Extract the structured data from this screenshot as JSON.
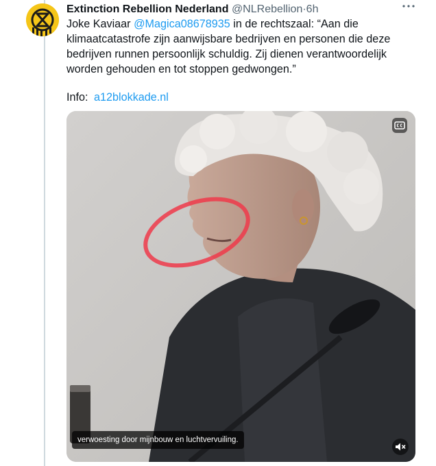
{
  "author": {
    "display_name": "Extinction Rebellion Nederland",
    "handle": "@NLRebellion",
    "separator": "·",
    "time": "6h",
    "avatar_icon": "extinction-symbol-icon",
    "avatar_color": "#f5c518"
  },
  "tweet": {
    "line1_prefix": "Joke Kaviaar",
    "mention": "@Magica08678935",
    "line1_suffix": "in de rechtszaal: “Aan die",
    "line2": "klimaatcatastrofe zijn aanwijsbare bedrijven en personen die deze",
    "line3": "bedrijven runnen persoonlijk schuldig. Zij dienen verantwoordelijk",
    "line4": "worden gehouden en tot stoppen gedwongen.”",
    "info_label": "Info:",
    "info_link": "a12blokkade.nl"
  },
  "media": {
    "caption": "verwoesting door mijnbouw en luchtvervuiling.",
    "cc_icon": "closed-captions-icon",
    "mute_icon": "speaker-muted-icon",
    "highlight_color": "#ef3a4a"
  },
  "colors": {
    "link": "#1d9bf0",
    "text": "#0f1419",
    "secondary": "#536471"
  }
}
